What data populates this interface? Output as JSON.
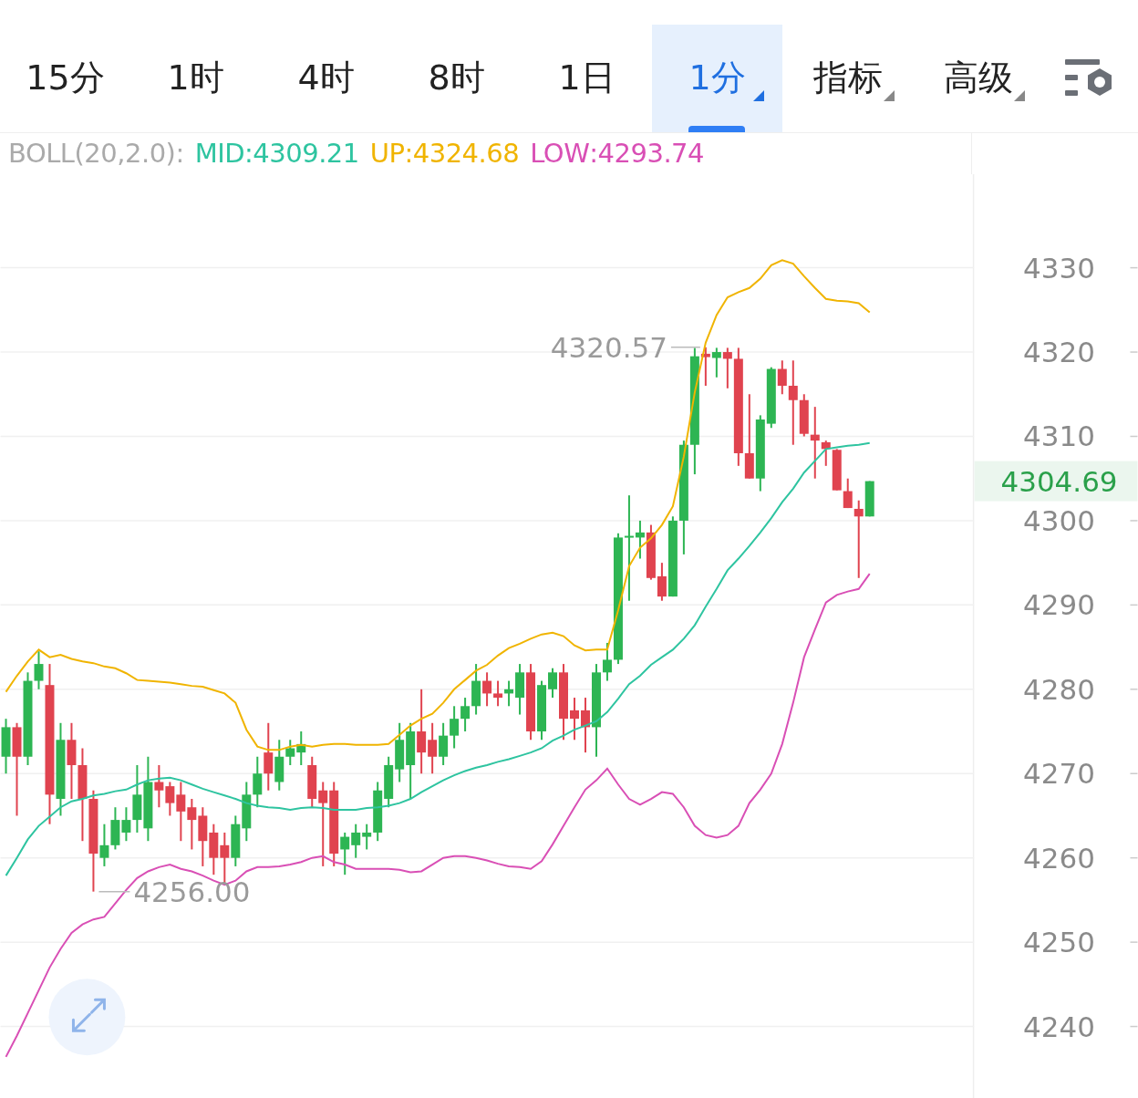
{
  "tabs": [
    {
      "label": "15分",
      "selected": false,
      "dropdown": false
    },
    {
      "label": "1时",
      "selected": false,
      "dropdown": false
    },
    {
      "label": "4时",
      "selected": false,
      "dropdown": false
    },
    {
      "label": "8时",
      "selected": false,
      "dropdown": false
    },
    {
      "label": "1日",
      "selected": false,
      "dropdown": false
    },
    {
      "label": "1分",
      "selected": true,
      "dropdown": true
    },
    {
      "label": "指标",
      "selected": false,
      "dropdown": true
    },
    {
      "label": "高级",
      "selected": false,
      "dropdown": true
    }
  ],
  "legend": {
    "title": "BOLL(20,2.0):",
    "values": [
      ":4309.21",
      ":4324.68",
      ":4293.74"
    ]
  },
  "chart_data": {
    "type": "candlestick",
    "grid": true,
    "ylim": [
      4231.5,
      4341.1
    ],
    "yticks": [
      4240,
      4250,
      4260,
      4270,
      4280,
      4290,
      4300,
      4310,
      4320,
      4330
    ],
    "categories": [
      null,
      null,
      null,
      null,
      null,
      null,
      null,
      null,
      null,
      null,
      null,
      null,
      null,
      null,
      null,
      null,
      null,
      null,
      null,
      null,
      null,
      null,
      null,
      null,
      null,
      null,
      null,
      null,
      null,
      null,
      null,
      null,
      null,
      null,
      null,
      null,
      null,
      null,
      null,
      null,
      null,
      null,
      null,
      null,
      null,
      null,
      null,
      null,
      null,
      null,
      null,
      null,
      null,
      null,
      null,
      null,
      null,
      null,
      null,
      null,
      null,
      null,
      null,
      null,
      null,
      null,
      null,
      null,
      null,
      null,
      null,
      null,
      null,
      null,
      null,
      null,
      null,
      null,
      null,
      null,
      null,
      null,
      null,
      null,
      null,
      null,
      null,
      null,
      null
    ],
    "ohlc": [
      [
        4272,
        4276.5,
        4270,
        4275.5
      ],
      [
        4275.5,
        4276,
        4265,
        4272
      ],
      [
        4272,
        4282,
        4271,
        4281
      ],
      [
        4281,
        4284.5,
        4280,
        4283
      ],
      [
        4280.5,
        4283,
        4264,
        4267.5
      ],
      [
        4267,
        4276,
        4265,
        4274
      ],
      [
        4274,
        4276,
        4267,
        4271
      ],
      [
        4271,
        4273,
        4262,
        4267
      ],
      [
        4267,
        4268,
        4256,
        4260.5
      ],
      [
        4260,
        4264,
        4259,
        4261.5
      ],
      [
        4261.5,
        4266,
        4261,
        4264.5
      ],
      [
        4263,
        4266,
        4262,
        4264.5
      ],
      [
        4264.5,
        4271,
        4263,
        4267.5
      ],
      [
        4263.5,
        4272,
        4262,
        4269
      ],
      [
        4269,
        4271,
        4266,
        4268
      ],
      [
        4268.5,
        4269,
        4265,
        4266.5
      ],
      [
        4267.5,
        4269,
        4262,
        4265.5
      ],
      [
        4266,
        4267,
        4261,
        4264.5
      ],
      [
        4265,
        4266,
        4259,
        4262
      ],
      [
        4263,
        4264,
        4258,
        4260
      ],
      [
        4261.5,
        4263,
        4257,
        4260
      ],
      [
        4260,
        4265,
        4259,
        4264
      ],
      [
        4263.5,
        4269,
        4262,
        4267.5
      ],
      [
        4267.5,
        4272,
        4266,
        4270
      ],
      [
        4272.5,
        4276,
        4268,
        4270
      ],
      [
        4269,
        4274,
        4268,
        4272
      ],
      [
        4272,
        4274,
        4271,
        4273
      ],
      [
        4272.5,
        4275,
        4271,
        4273.5
      ],
      [
        4271,
        4272,
        4266,
        4267
      ],
      [
        4268,
        4269,
        4259,
        4266.5
      ],
      [
        4268,
        4269,
        4259,
        4260.5
      ],
      [
        4261,
        4263,
        4258,
        4262.5
      ],
      [
        4261.5,
        4264,
        4260,
        4263
      ],
      [
        4262.5,
        4264,
        4261,
        4263
      ],
      [
        4263,
        4269,
        4262,
        4268
      ],
      [
        4267,
        4272,
        4266,
        4271
      ],
      [
        4270.5,
        4276,
        4269,
        4274
      ],
      [
        4271,
        4276,
        4267,
        4275
      ],
      [
        4275,
        4280,
        4270,
        4272.5
      ],
      [
        4274,
        4276,
        4270,
        4272
      ],
      [
        4272,
        4276,
        4271,
        4274.5
      ],
      [
        4274.5,
        4278,
        4273,
        4276.5
      ],
      [
        4276.5,
        4279,
        4275,
        4278
      ],
      [
        4278,
        4283,
        4277,
        4281
      ],
      [
        4281,
        4282,
        4278,
        4279.5
      ],
      [
        4279.5,
        4281,
        4278,
        4279
      ],
      [
        4279.5,
        4281,
        4278,
        4280
      ],
      [
        4279,
        4283,
        4277,
        4282
      ],
      [
        4282,
        4283,
        4274,
        4275
      ],
      [
        4275,
        4281,
        4274,
        4280.5
      ],
      [
        4280,
        4282.5,
        4279,
        4282
      ],
      [
        4282,
        4283,
        4274,
        4276.5
      ],
      [
        4277.5,
        4279,
        4274,
        4276.5
      ],
      [
        4277.5,
        4279,
        4272.5,
        4275.5
      ],
      [
        4275.5,
        4283,
        4272,
        4282
      ],
      [
        4282,
        4285.5,
        4281,
        4283.5
      ],
      [
        4283.5,
        4298.5,
        4283,
        4298
      ],
      [
        4298,
        4303,
        4290.5,
        4298.2
      ],
      [
        4298,
        4300,
        4295.5,
        4298.6
      ],
      [
        4298.6,
        4299.5,
        4293,
        4293.2
      ],
      [
        4293.4,
        4295,
        4290.5,
        4291
      ],
      [
        4291,
        4300.5,
        4291,
        4300
      ],
      [
        4300,
        4309.5,
        4296,
        4309
      ],
      [
        4309,
        4320.5,
        4305.5,
        4319.5
      ],
      [
        4319.8,
        4320.57,
        4316,
        4319.4
      ],
      [
        4319.3,
        4320.5,
        4317,
        4320
      ],
      [
        4320,
        4320.5,
        4315.7,
        4319.2
      ],
      [
        4319.2,
        4320.5,
        4306.5,
        4308
      ],
      [
        4308,
        4315,
        4305,
        4305
      ],
      [
        4305,
        4312.5,
        4303.5,
        4312
      ],
      [
        4311.5,
        4318.2,
        4311,
        4318
      ],
      [
        4318,
        4319,
        4315,
        4316
      ],
      [
        4316,
        4319,
        4309,
        4314.3
      ],
      [
        4314.3,
        4315,
        4310,
        4310.3
      ],
      [
        4310.2,
        4313.5,
        4305,
        4309.5
      ],
      [
        4309.3,
        4309.5,
        4306.5,
        4308.5
      ],
      [
        4308.4,
        4308.5,
        4303.6,
        4303.6
      ],
      [
        4303.5,
        4305,
        4301.5,
        4301.5
      ],
      [
        4301.4,
        4302.4,
        4293.2,
        4300.5
      ],
      [
        4300.5,
        4304.69,
        4300.5,
        4304.69
      ],
      null,
      null,
      null,
      null,
      null,
      null,
      null,
      null,
      null
    ],
    "series": [
      {
        "name": "MID",
        "type": "line",
        "color": "#2ec4a0",
        "values": [
          4257.9,
          4260.0,
          4262.2,
          4263.8,
          4264.9,
          4266.0,
          4266.7,
          4267.0,
          4267.4,
          4267.6,
          4267.9,
          4268.1,
          4268.7,
          4269.2,
          4269.4,
          4269.5,
          4269.2,
          4268.7,
          4268.2,
          4267.8,
          4267.4,
          4267.0,
          4266.5,
          4266.2,
          4266.0,
          4265.9,
          4265.7,
          4265.9,
          4266.0,
          4265.9,
          4265.7,
          4265.7,
          4265.7,
          4265.9,
          4266.0,
          4266.2,
          4266.5,
          4267.0,
          4267.8,
          4268.5,
          4269.2,
          4269.8,
          4270.3,
          4270.7,
          4271.0,
          4271.4,
          4271.7,
          4272.1,
          4272.5,
          4273.0,
          4273.9,
          4274.5,
          4275.2,
          4275.7,
          4276.2,
          4277.3,
          4278.9,
          4280.6,
          4281.6,
          4282.9,
          4283.8,
          4284.7,
          4286.0,
          4287.6,
          4289.8,
          4291.9,
          4294.1,
          4295.5,
          4297.0,
          4298.6,
          4300.3,
          4302.2,
          4303.8,
          4305.7,
          4307.1,
          4308.5,
          4308.7,
          4308.9,
          4309.0,
          4309.2,
          null,
          null,
          null,
          null,
          null,
          null,
          null,
          null,
          null
        ]
      },
      {
        "name": "UP",
        "type": "line",
        "color": "#f0b400",
        "values": [
          4279.7,
          4281.6,
          4283.3,
          4284.7,
          4283.8,
          4284.1,
          4283.6,
          4283.3,
          4283.1,
          4282.7,
          4282.5,
          4281.9,
          4281.1,
          4281.0,
          4280.9,
          4280.8,
          4280.6,
          4280.4,
          4280.3,
          4279.9,
          4279.5,
          4278.4,
          4275.2,
          4273.2,
          4272.8,
          4272.8,
          4273.2,
          4273.4,
          4273.2,
          4273.4,
          4273.5,
          4273.5,
          4273.4,
          4273.4,
          4273.4,
          4273.5,
          4274.6,
          4275.7,
          4276.5,
          4277.1,
          4278.4,
          4280.0,
          4281.1,
          4282.2,
          4282.9,
          4284.0,
          4284.9,
          4285.4,
          4286.0,
          4286.5,
          4286.7,
          4286.3,
          4285.2,
          4284.6,
          4284.7,
          4284.7,
          4289.4,
          4294.6,
          4296.8,
          4297.9,
          4299.5,
          4301.7,
          4307.6,
          4315.2,
          4321.1,
          4324.4,
          4326.5,
          4327.1,
          4327.6,
          4328.7,
          4330.3,
          4330.9,
          4330.5,
          4329.0,
          4327.6,
          4326.3,
          4326.1,
          4326.0,
          4325.8,
          4324.7,
          null,
          null,
          null,
          null,
          null,
          null,
          null,
          null,
          null
        ]
      },
      {
        "name": "LOW",
        "type": "line",
        "color": "#d94fb5",
        "values": [
          4236.4,
          4238.9,
          4241.6,
          4244.3,
          4247.0,
          4249.2,
          4251.1,
          4252.1,
          4252.7,
          4253.0,
          4254.6,
          4256.2,
          4257.6,
          4258.4,
          4258.9,
          4259.2,
          4258.7,
          4258.4,
          4257.9,
          4257.3,
          4256.8,
          4257.3,
          4258.4,
          4258.9,
          4258.9,
          4259.0,
          4259.2,
          4259.5,
          4260.0,
          4260.2,
          4259.5,
          4259.2,
          4258.7,
          4258.7,
          4258.7,
          4258.7,
          4258.6,
          4258.3,
          4258.4,
          4259.2,
          4260.0,
          4260.2,
          4260.2,
          4260.0,
          4259.7,
          4259.3,
          4259.0,
          4258.9,
          4258.7,
          4259.6,
          4261.6,
          4263.8,
          4266.0,
          4268.1,
          4269.2,
          4270.6,
          4268.7,
          4267.0,
          4266.3,
          4267.0,
          4267.8,
          4267.6,
          4266.0,
          4263.8,
          4262.7,
          4262.4,
          4262.7,
          4263.8,
          4266.5,
          4268.1,
          4270.0,
          4273.5,
          4278.4,
          4283.8,
          4287.1,
          4290.3,
          4291.2,
          4291.6,
          4291.9,
          4293.7,
          null,
          null,
          null,
          null,
          null,
          null,
          null,
          null,
          null
        ]
      }
    ],
    "annotations": [
      "4320.57",
      "4256.00",
      "4304.69"
    ]
  }
}
